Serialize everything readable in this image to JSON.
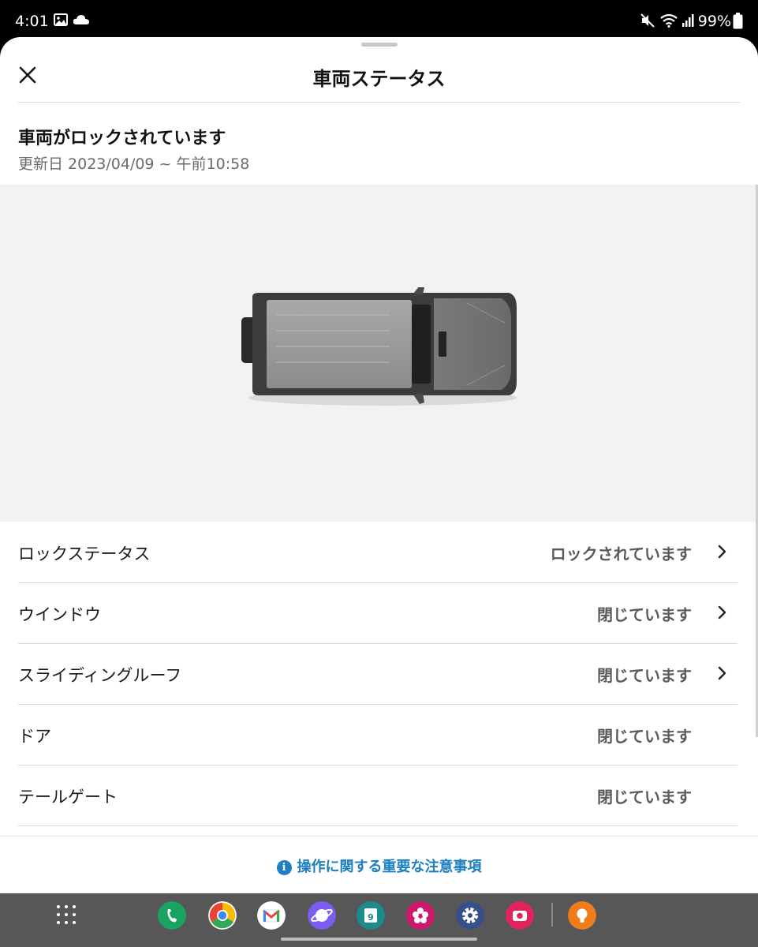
{
  "status_bar": {
    "time": "4:01",
    "battery_percent": "99%",
    "icons": [
      "image-icon",
      "cloud-icon",
      "mute-icon",
      "wifi-icon",
      "signal-icon",
      "battery-icon"
    ]
  },
  "sheet": {
    "title": "車両ステータス",
    "lock_heading": "車両がロックされています",
    "updated_label": "更新日",
    "updated_value": "2023/04/09 ~ 午前10:58"
  },
  "status_rows": [
    {
      "label": "ロックステータス",
      "value": "ロックされています",
      "has_chevron": true
    },
    {
      "label": "ウインドウ",
      "value": "閉じています",
      "has_chevron": true
    },
    {
      "label": "スライディングルーフ",
      "value": "閉じています",
      "has_chevron": true
    },
    {
      "label": "ドア",
      "value": "閉じています",
      "has_chevron": false
    },
    {
      "label": "テールゲート",
      "value": "閉じています",
      "has_chevron": false
    }
  ],
  "footer": {
    "notice_link": "操作に関する重要な注意事項"
  },
  "taskbar": {
    "apps": [
      "phone-app-icon",
      "chrome-app-icon",
      "gmail-app-icon",
      "internet-app-icon",
      "calendar-app-icon",
      "gallery-app-icon",
      "settings-app-icon",
      "camera-app-icon",
      "tips-app-icon"
    ],
    "calendar_day": "9"
  },
  "colors": {
    "link_blue": "#1c7fc0",
    "vehicle_area_bg": "#f2f2f2",
    "taskbar_bg": "#575757"
  }
}
